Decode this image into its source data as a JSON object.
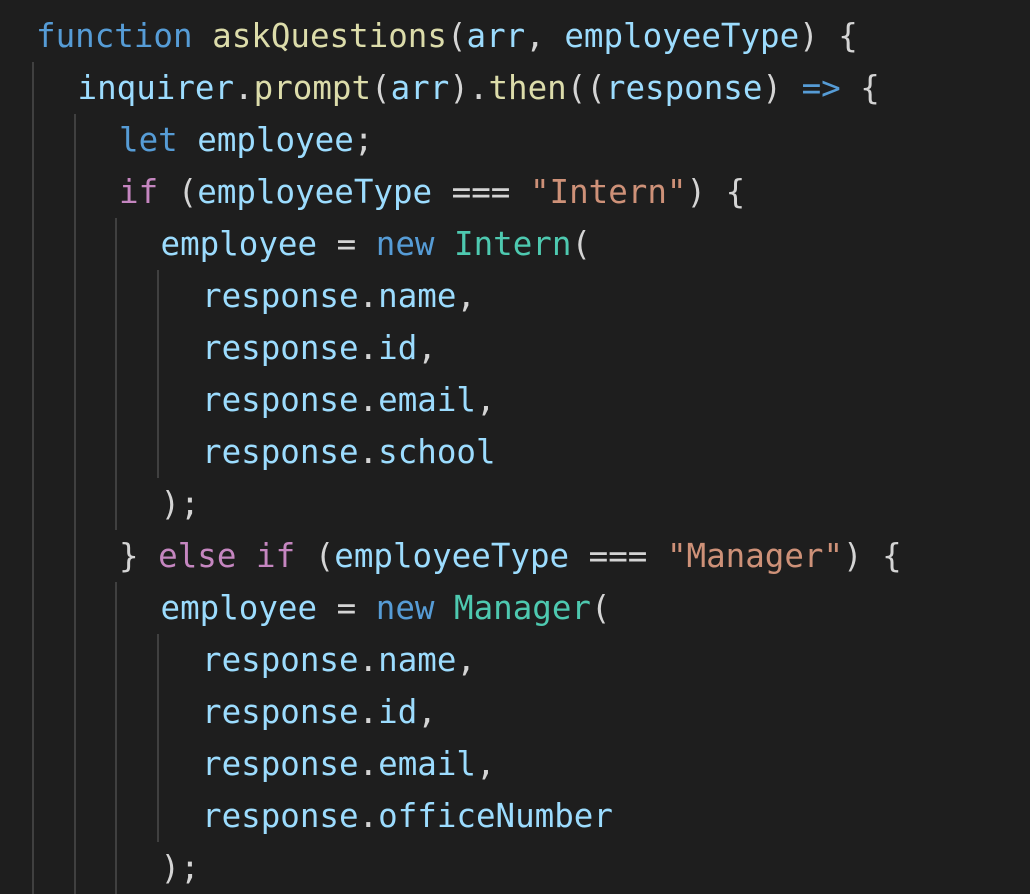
{
  "editor": {
    "language": "javascript",
    "colors": {
      "background": "#1e1e1e",
      "indent_guide": "#404040",
      "keyword": "#569cd6",
      "control": "#c586c0",
      "function": "#dcdcaa",
      "variable": "#9cdcfe",
      "class": "#4ec9b0",
      "string": "#ce9178",
      "punctuation": "#d4d4d4"
    },
    "lines": [
      {
        "indent": 0,
        "tokens": [
          {
            "t": "function",
            "c": "kw"
          },
          {
            "t": " ",
            "c": "punc"
          },
          {
            "t": "askQuestions",
            "c": "fn"
          },
          {
            "t": "(",
            "c": "punc"
          },
          {
            "t": "arr",
            "c": "var"
          },
          {
            "t": ", ",
            "c": "punc"
          },
          {
            "t": "employeeType",
            "c": "var"
          },
          {
            "t": ") {",
            "c": "punc"
          }
        ]
      },
      {
        "indent": 1,
        "tokens": [
          {
            "t": "inquirer",
            "c": "var"
          },
          {
            "t": ".",
            "c": "punc"
          },
          {
            "t": "prompt",
            "c": "fn"
          },
          {
            "t": "(",
            "c": "punc"
          },
          {
            "t": "arr",
            "c": "var"
          },
          {
            "t": ").",
            "c": "punc"
          },
          {
            "t": "then",
            "c": "fn"
          },
          {
            "t": "((",
            "c": "punc"
          },
          {
            "t": "response",
            "c": "var"
          },
          {
            "t": ") ",
            "c": "punc"
          },
          {
            "t": "=>",
            "c": "kw"
          },
          {
            "t": " {",
            "c": "punc"
          }
        ]
      },
      {
        "indent": 2,
        "tokens": [
          {
            "t": "let",
            "c": "kw"
          },
          {
            "t": " ",
            "c": "punc"
          },
          {
            "t": "employee",
            "c": "var"
          },
          {
            "t": ";",
            "c": "punc"
          }
        ]
      },
      {
        "indent": 2,
        "tokens": [
          {
            "t": "if",
            "c": "ctrl"
          },
          {
            "t": " (",
            "c": "punc"
          },
          {
            "t": "employeeType",
            "c": "var"
          },
          {
            "t": " === ",
            "c": "punc"
          },
          {
            "t": "\"Intern\"",
            "c": "str"
          },
          {
            "t": ") {",
            "c": "punc"
          }
        ]
      },
      {
        "indent": 3,
        "tokens": [
          {
            "t": "employee",
            "c": "var"
          },
          {
            "t": " = ",
            "c": "punc"
          },
          {
            "t": "new",
            "c": "kw"
          },
          {
            "t": " ",
            "c": "punc"
          },
          {
            "t": "Intern",
            "c": "cls"
          },
          {
            "t": "(",
            "c": "punc"
          }
        ]
      },
      {
        "indent": 4,
        "tokens": [
          {
            "t": "response",
            "c": "var"
          },
          {
            "t": ".",
            "c": "punc"
          },
          {
            "t": "name",
            "c": "var"
          },
          {
            "t": ",",
            "c": "punc"
          }
        ]
      },
      {
        "indent": 4,
        "tokens": [
          {
            "t": "response",
            "c": "var"
          },
          {
            "t": ".",
            "c": "punc"
          },
          {
            "t": "id",
            "c": "var"
          },
          {
            "t": ",",
            "c": "punc"
          }
        ]
      },
      {
        "indent": 4,
        "tokens": [
          {
            "t": "response",
            "c": "var"
          },
          {
            "t": ".",
            "c": "punc"
          },
          {
            "t": "email",
            "c": "var"
          },
          {
            "t": ",",
            "c": "punc"
          }
        ]
      },
      {
        "indent": 4,
        "tokens": [
          {
            "t": "response",
            "c": "var"
          },
          {
            "t": ".",
            "c": "punc"
          },
          {
            "t": "school",
            "c": "var"
          }
        ]
      },
      {
        "indent": 3,
        "tokens": [
          {
            "t": ");",
            "c": "punc"
          }
        ]
      },
      {
        "indent": 2,
        "tokens": [
          {
            "t": "} ",
            "c": "punc"
          },
          {
            "t": "else",
            "c": "ctrl"
          },
          {
            "t": " ",
            "c": "punc"
          },
          {
            "t": "if",
            "c": "ctrl"
          },
          {
            "t": " (",
            "c": "punc"
          },
          {
            "t": "employeeType",
            "c": "var"
          },
          {
            "t": " === ",
            "c": "punc"
          },
          {
            "t": "\"Manager\"",
            "c": "str"
          },
          {
            "t": ") {",
            "c": "punc"
          }
        ]
      },
      {
        "indent": 3,
        "tokens": [
          {
            "t": "employee",
            "c": "var"
          },
          {
            "t": " = ",
            "c": "punc"
          },
          {
            "t": "new",
            "c": "kw"
          },
          {
            "t": " ",
            "c": "punc"
          },
          {
            "t": "Manager",
            "c": "cls"
          },
          {
            "t": "(",
            "c": "punc"
          }
        ]
      },
      {
        "indent": 4,
        "tokens": [
          {
            "t": "response",
            "c": "var"
          },
          {
            "t": ".",
            "c": "punc"
          },
          {
            "t": "name",
            "c": "var"
          },
          {
            "t": ",",
            "c": "punc"
          }
        ]
      },
      {
        "indent": 4,
        "tokens": [
          {
            "t": "response",
            "c": "var"
          },
          {
            "t": ".",
            "c": "punc"
          },
          {
            "t": "id",
            "c": "var"
          },
          {
            "t": ",",
            "c": "punc"
          }
        ]
      },
      {
        "indent": 4,
        "tokens": [
          {
            "t": "response",
            "c": "var"
          },
          {
            "t": ".",
            "c": "punc"
          },
          {
            "t": "email",
            "c": "var"
          },
          {
            "t": ",",
            "c": "punc"
          }
        ]
      },
      {
        "indent": 4,
        "tokens": [
          {
            "t": "response",
            "c": "var"
          },
          {
            "t": ".",
            "c": "punc"
          },
          {
            "t": "officeNumber",
            "c": "var"
          }
        ]
      },
      {
        "indent": 3,
        "tokens": [
          {
            "t": ");",
            "c": "punc"
          }
        ]
      }
    ]
  }
}
